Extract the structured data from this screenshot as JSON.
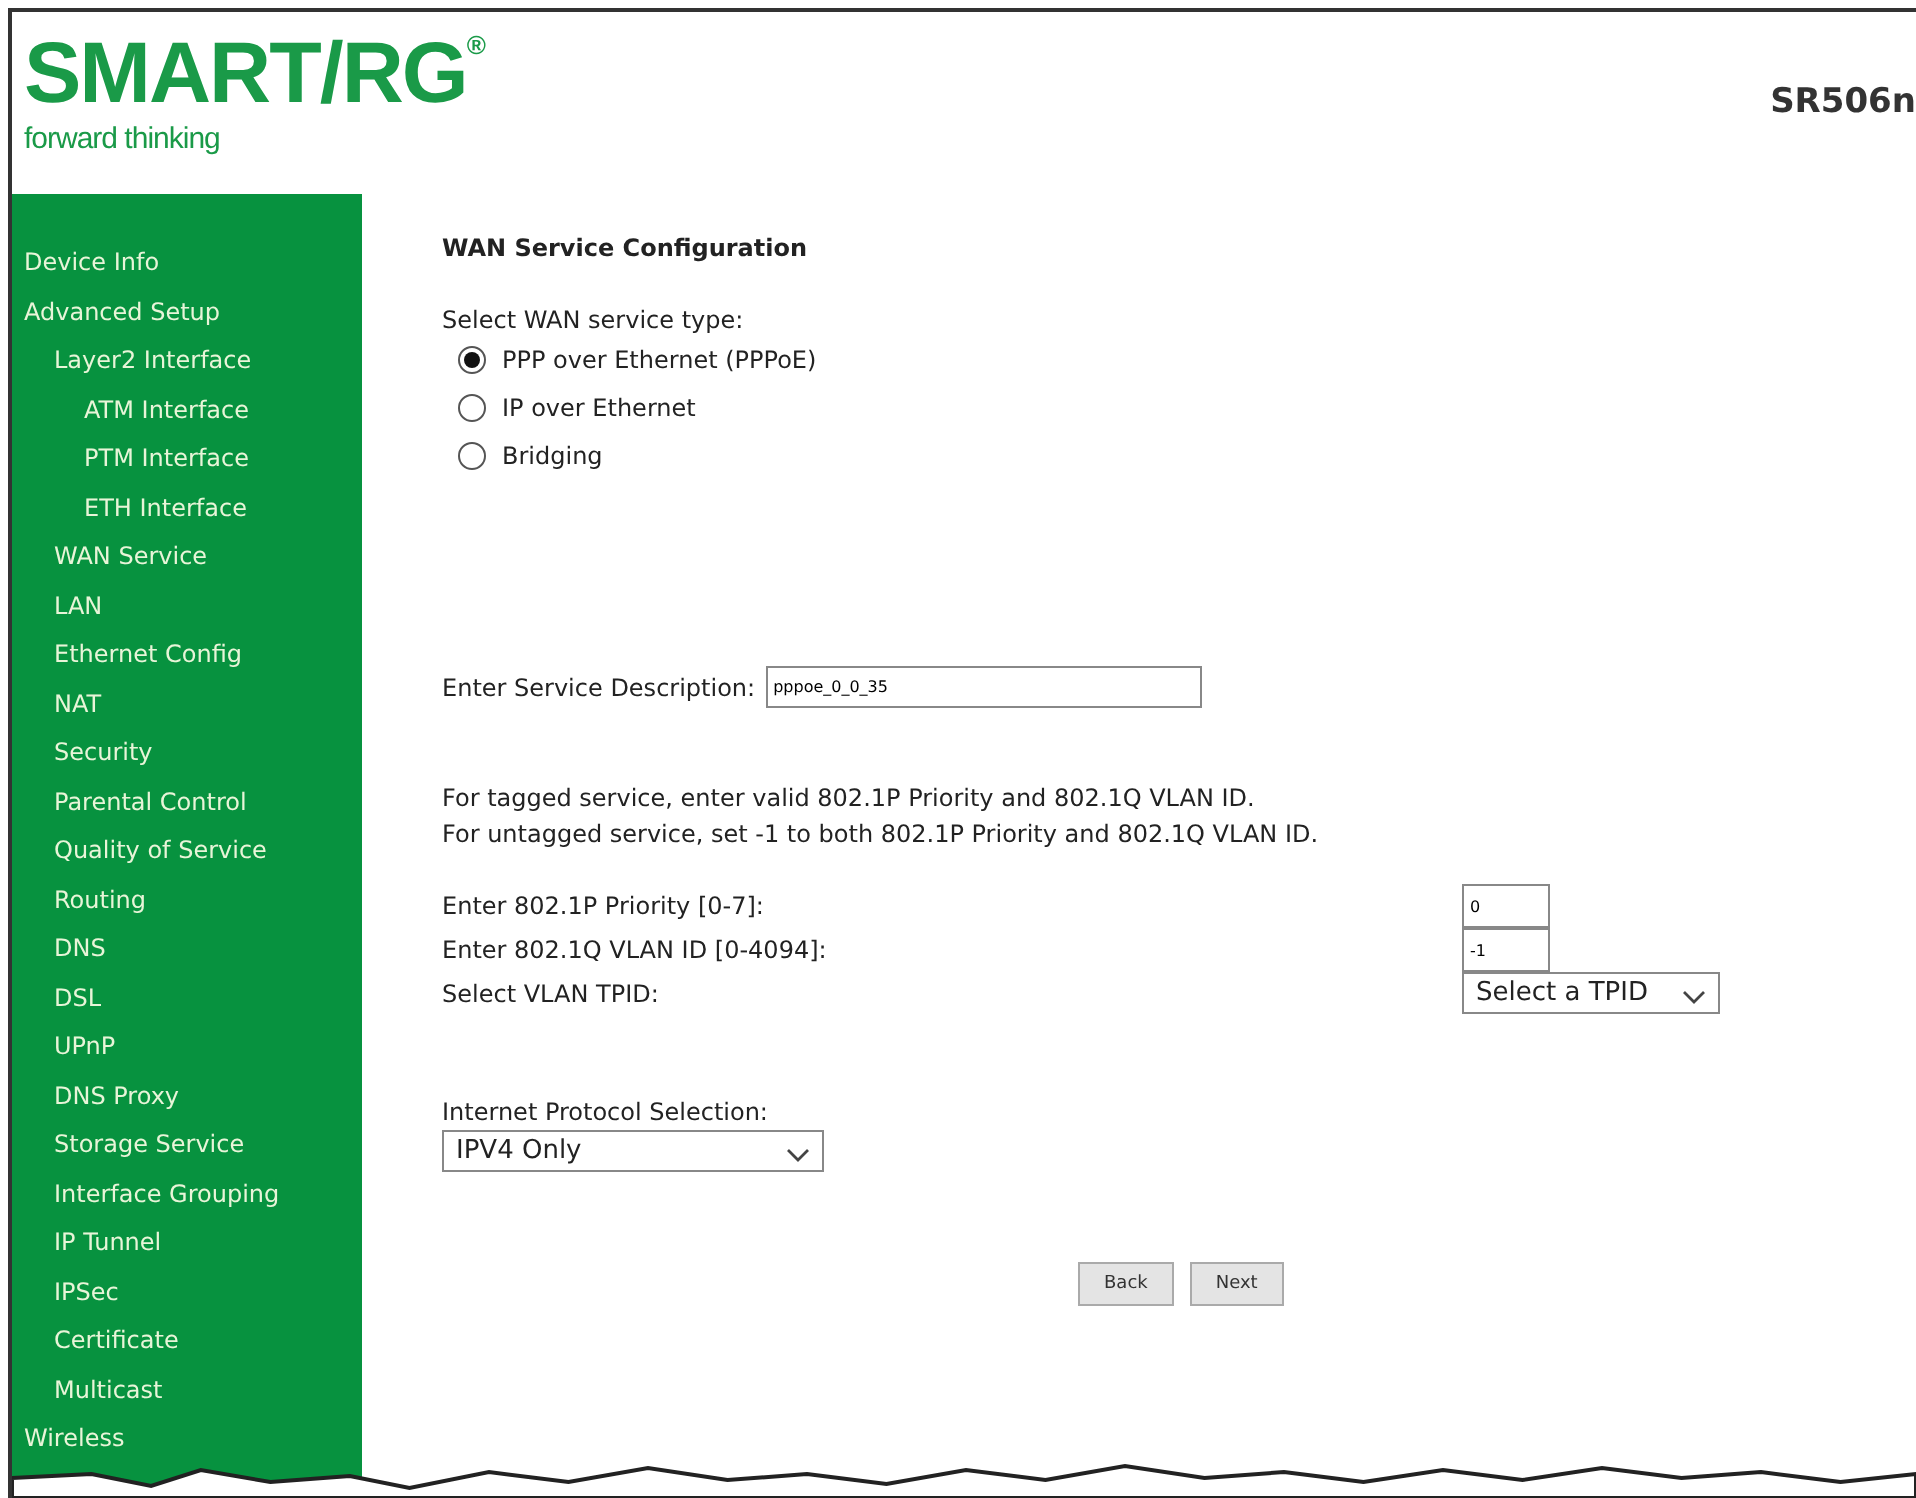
{
  "header": {
    "logo": "SMART/RG",
    "logo_mark": "®",
    "tagline": "forward thinking",
    "model": "SR506n"
  },
  "sidebar": {
    "items": [
      {
        "label": "Device Info"
      },
      {
        "label": "Advanced Setup",
        "children": [
          {
            "label": "Layer2 Interface",
            "children": [
              {
                "label": "ATM Interface"
              },
              {
                "label": "PTM Interface"
              },
              {
                "label": "ETH Interface"
              }
            ]
          },
          {
            "label": "WAN Service"
          },
          {
            "label": "LAN"
          },
          {
            "label": "Ethernet Config"
          },
          {
            "label": "NAT"
          },
          {
            "label": "Security"
          },
          {
            "label": "Parental Control"
          },
          {
            "label": "Quality of Service"
          },
          {
            "label": "Routing"
          },
          {
            "label": "DNS"
          },
          {
            "label": "DSL"
          },
          {
            "label": "UPnP"
          },
          {
            "label": "DNS Proxy"
          },
          {
            "label": "Storage Service"
          },
          {
            "label": "Interface Grouping"
          },
          {
            "label": "IP Tunnel"
          },
          {
            "label": "IPSec"
          },
          {
            "label": "Certificate"
          },
          {
            "label": "Multicast"
          }
        ]
      },
      {
        "label": "Wireless"
      }
    ]
  },
  "form": {
    "title": "WAN Service Configuration",
    "service_type_label": "Select WAN service type:",
    "service_types": [
      {
        "label": "PPP over Ethernet (PPPoE)",
        "selected": true
      },
      {
        "label": "IP over Ethernet",
        "selected": false
      },
      {
        "label": "Bridging",
        "selected": false
      }
    ],
    "description_label": "Enter Service Description:",
    "description_value": "pppoe_0_0_35",
    "notes": [
      "For tagged service, enter valid 802.1P Priority and 802.1Q VLAN ID.",
      "For untagged service, set -1 to both 802.1P Priority and 802.1Q VLAN ID."
    ],
    "priority_label": "Enter 802.1P Priority [0-7]:",
    "priority_value": "0",
    "vlan_id_label": "Enter 802.1Q VLAN ID [0-4094]:",
    "vlan_id_value": "-1",
    "tpid_label": "Select VLAN TPID:",
    "tpid_value": "Select a TPID",
    "protocol_label": "Internet Protocol Selection:",
    "protocol_value": "IPV4 Only",
    "buttons": [
      "Back",
      "Next"
    ]
  }
}
